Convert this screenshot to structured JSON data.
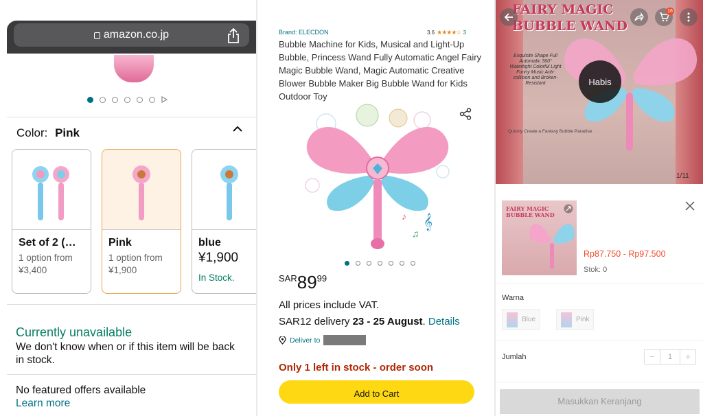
{
  "panel1": {
    "url": "amazon.co.jp",
    "color_label": "Color:",
    "color_value": "Pink",
    "options": [
      {
        "title": "Set of 2 (…",
        "sub": "1 option from",
        "price": "¥3,400"
      },
      {
        "title": "Pink",
        "sub": "1 option from",
        "price": "¥1,900"
      },
      {
        "title": "blue",
        "price": "¥1,900",
        "stock": "In Stock."
      }
    ],
    "unavailable_title": "Currently unavailable",
    "unavailable_text": "We don't know when or if this item will be back in stock.",
    "no_offers": "No featured offers available",
    "learn_more": "Learn more"
  },
  "panel2": {
    "brand": "Brand: ELECDON",
    "rating": "3.6",
    "stars": "★★★★☆",
    "rating_count": "3",
    "title": "Bubble Machine for Kids, Musical and Light-Up Bubble, Princess Wand Fully Automatic Angel Fairy Magic Bubble Wand, Magic Automatic Creative Blower Bubble Maker Big Bubble Wand for Kids Outdoor Toy",
    "price_currency": "SAR",
    "price_whole": "89",
    "price_fraction": "99",
    "vat": "All prices include VAT.",
    "delivery_prefix": "SAR12 delivery ",
    "delivery_dates": "23 - 25 August",
    "delivery_period": ". ",
    "details": "Details",
    "deliver_to": "Deliver to",
    "stock_warning": "Only 1 left in stock - order soon",
    "cart_button": "Add to Cart"
  },
  "panel3": {
    "banner_title_1": "FAIRY MAGIC",
    "banner_title_2": "BUBBLE WAND",
    "features": "Exquisite Shape Full Automatic 360° Watertight Colorful Light Funny Music Anti-collision and Broken-Resistant",
    "tagline": "Quickly Create a Fantasy Bubble Paradise",
    "habis": "Habis",
    "cart_count": "16",
    "image_counter": "1/11",
    "thumb_title_1": "FAIRY MAGIC",
    "thumb_title_2": "BUBBLE WAND",
    "price_range": "Rp87.750 - Rp97.500",
    "stock": "Stok: 0",
    "warna_label": "Warna",
    "warna_options": [
      "Blue",
      "Pink"
    ],
    "jumlah_label": "Jumlah",
    "quantity": "1",
    "add_button": "Masukkan Keranjang"
  }
}
